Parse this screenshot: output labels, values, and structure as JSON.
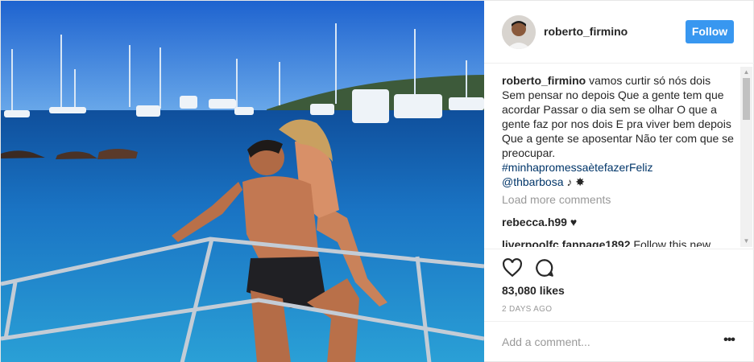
{
  "header": {
    "username": "roberto_firmino",
    "follow_label": "Follow"
  },
  "caption": {
    "username": "roberto_firmino",
    "text": "vamos curtir só nós dois Sem pensar no depois Que a gente tem que acordar Passar o dia sem se olhar O que a gente faz por nos dois E pra viver bem depois Que a gente se aposentar Não ter com que se preocupar.",
    "hashtag": "#minhapromessaètefazerFeliz",
    "mention": "@thbarbosa",
    "emoji": "♪ ✸"
  },
  "load_more_label": "Load more comments",
  "comments": [
    {
      "username": "rebecca.h99",
      "text": "♥"
    },
    {
      "username": "liverpoolfc.fanpage1892",
      "text": "Follow this new"
    }
  ],
  "likes_label": "83,080 likes",
  "timestamp": "2 DAYS AGO",
  "add_comment": {
    "placeholder": "Add a comment..."
  },
  "more_options_label": "•••",
  "colors": {
    "follow_bg": "#3897f0",
    "link": "#003569",
    "muted": "#999999",
    "sky": "#2f78d8",
    "sea": "#1d6fb8"
  }
}
